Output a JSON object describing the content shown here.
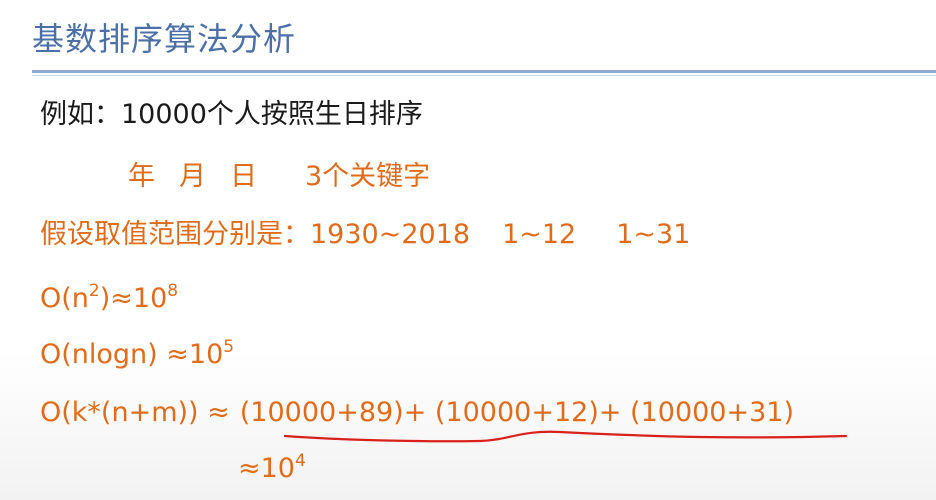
{
  "title": "基数排序算法分析",
  "lines": {
    "example": "例如：10000个人按照生日排序",
    "keys": {
      "year": "年",
      "month": "月",
      "day": "日",
      "count": "3个关键字"
    },
    "range": {
      "label": "假设取值范围分别是：",
      "year_range": "1930~2018",
      "month_range": "1~12",
      "day_range": "1~31"
    },
    "n2": {
      "base": "O(n",
      "exp1": "2",
      "mid": ")≈10",
      "exp2": "8"
    },
    "nlogn": {
      "base": "O(nlogn) ≈10",
      "exp": "5"
    },
    "kn": {
      "lhs": "O(k*(n+m)) ≈",
      "rhs": "(10000+89)+ (10000+12)+ (10000+31)"
    },
    "result": {
      "base": "≈10",
      "exp": "4"
    }
  },
  "colors": {
    "title": "#4d6fa8",
    "text_black": "#1a1a1a",
    "text_orange": "#e06c1b",
    "underline_red": "#d9201c"
  }
}
